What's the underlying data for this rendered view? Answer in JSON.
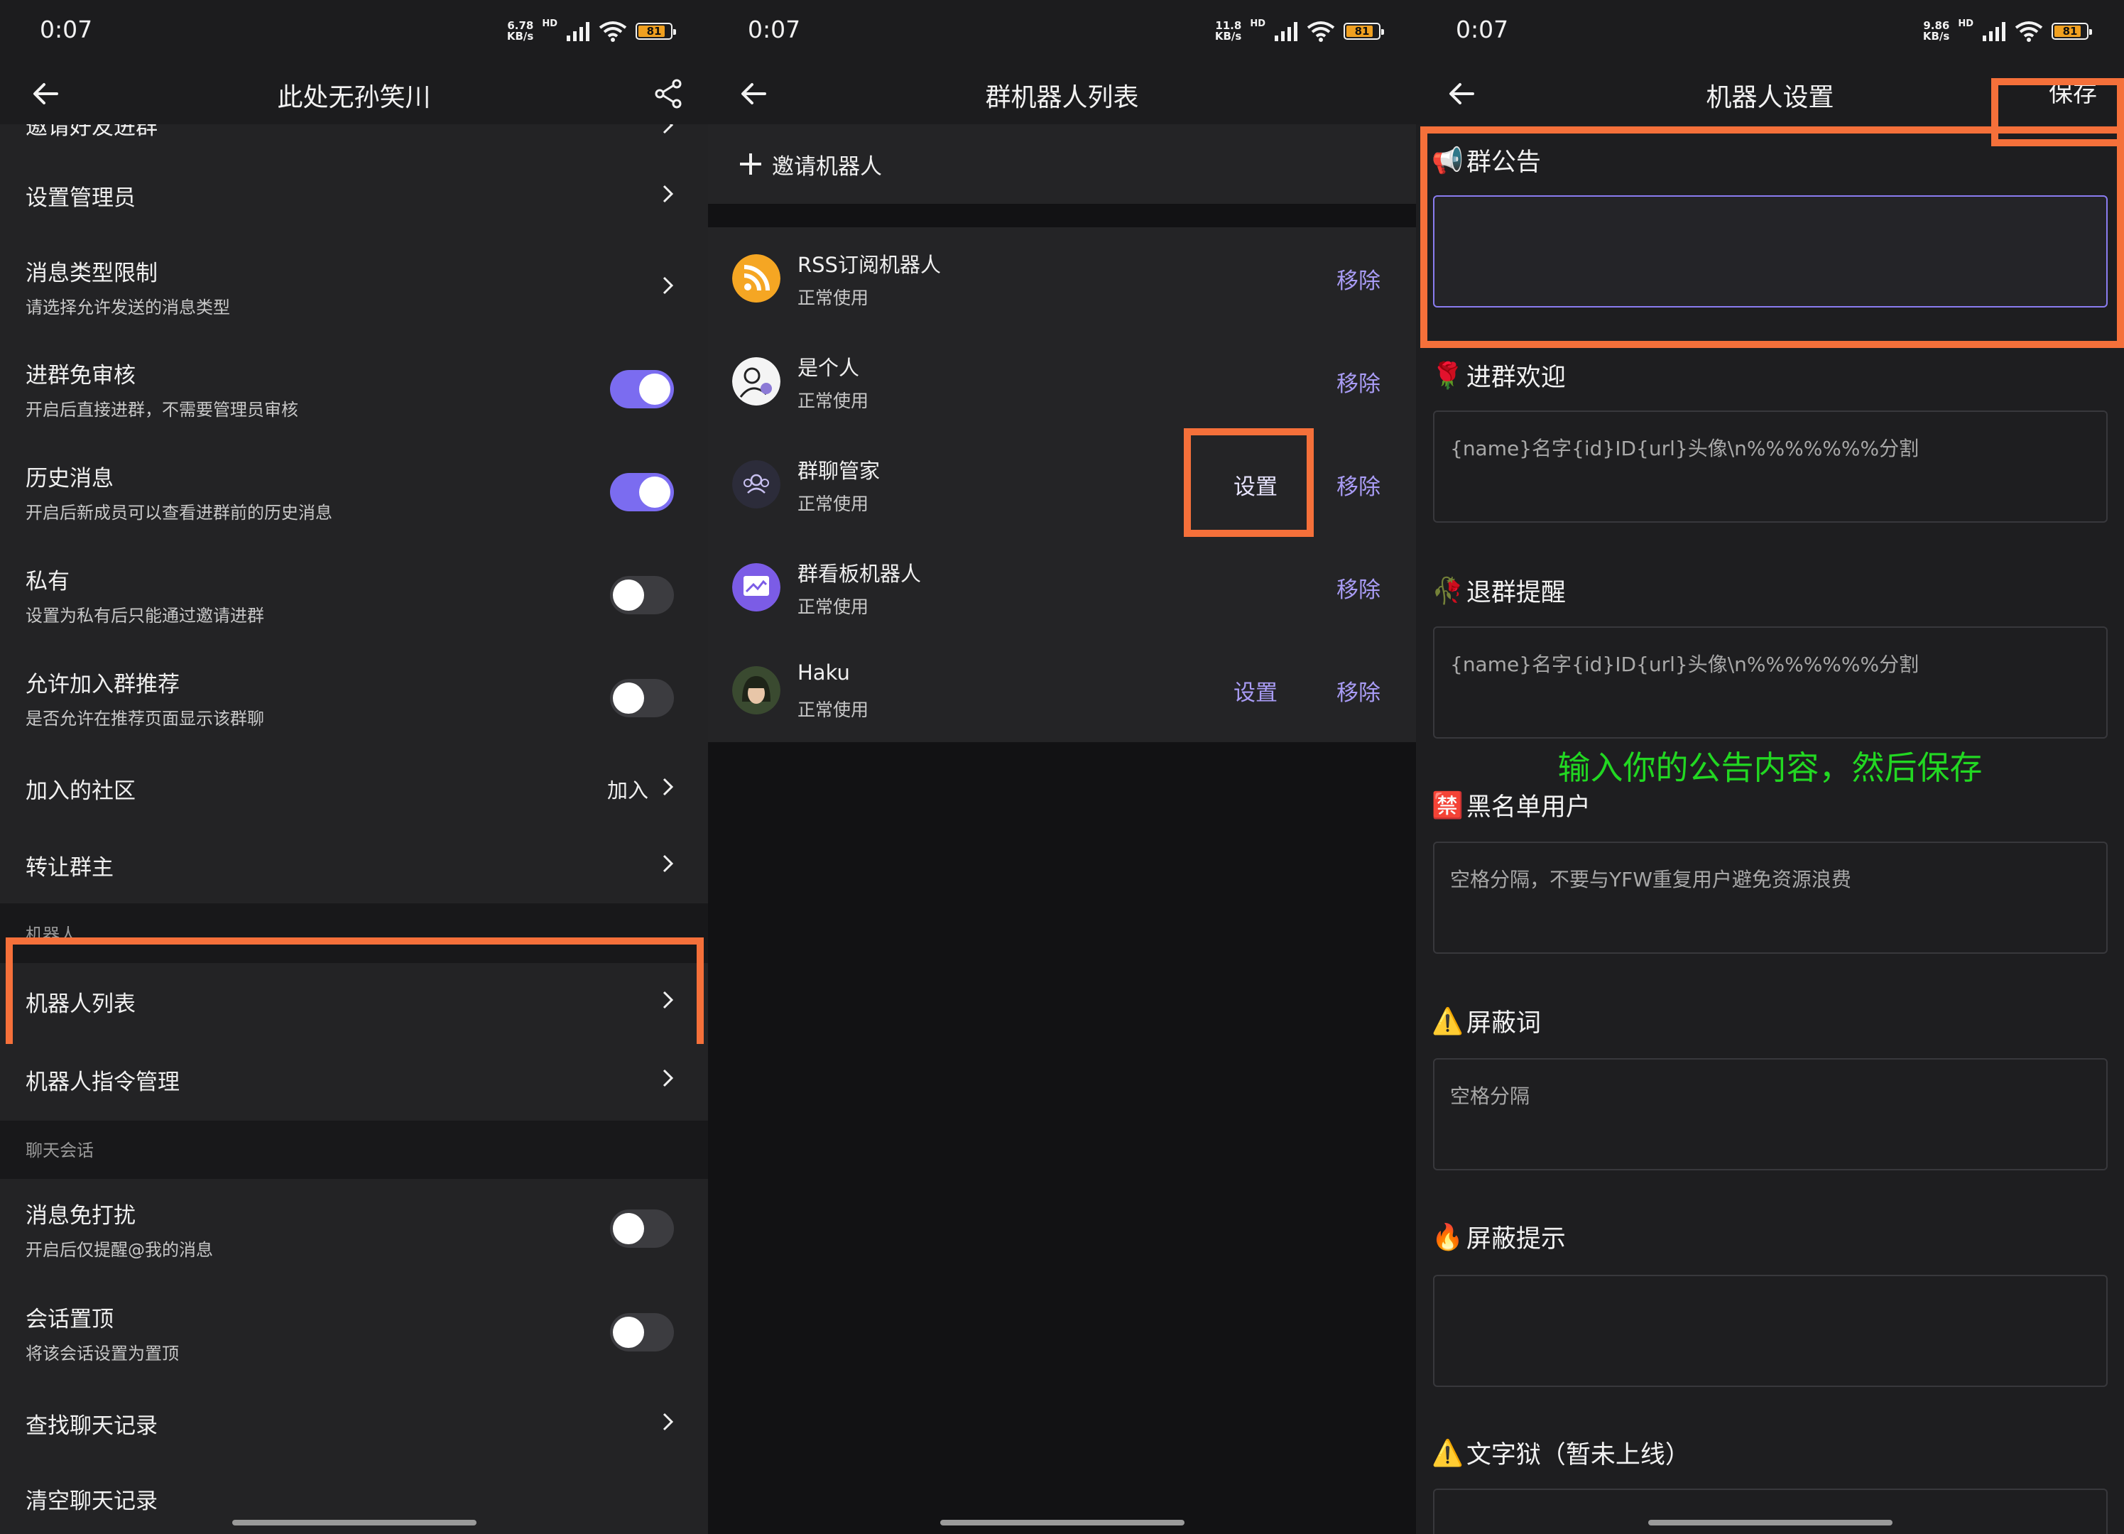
{
  "status": {
    "time": "0:07",
    "panels": [
      {
        "speed": "6.78",
        "unit": "KB/s",
        "battery": "81"
      },
      {
        "speed": "11.8",
        "unit": "KB/s",
        "battery": "81"
      },
      {
        "speed": "9.86",
        "unit": "KB/s",
        "battery": "81"
      }
    ],
    "hd": "HD"
  },
  "panel1": {
    "title": "此处无孙笑川",
    "cut_row": "邀请好友进群",
    "rows": [
      {
        "title": "设置管理员"
      },
      {
        "title": "消息类型限制",
        "sub": "请选择允许发送的消息类型"
      },
      {
        "title": "进群免审核",
        "sub": "开启后直接进群，不需要管理员审核"
      },
      {
        "title": "历史消息",
        "sub": "开启后新成员可以查看进群前的历史消息"
      },
      {
        "title": "私有",
        "sub": "设置为私有后只能通过邀请进群"
      },
      {
        "title": "允许加入群推荐",
        "sub": "是否允许在推荐页面显示该群聊"
      },
      {
        "title": "加入的社区",
        "value": "加入"
      },
      {
        "title": "转让群主"
      }
    ],
    "section_robot": "机器人",
    "robot_rows": [
      {
        "title": "机器人列表"
      },
      {
        "title": "机器人指令管理"
      }
    ],
    "section_chat": "聊天会话",
    "chat_rows": [
      {
        "title": "消息免打扰",
        "sub": "开启后仅提醒@我的消息"
      },
      {
        "title": "会话置顶",
        "sub": "将该会话设置为置顶"
      },
      {
        "title": "查找聊天记录"
      },
      {
        "title": "清空聊天记录"
      }
    ]
  },
  "panel2": {
    "title": "群机器人列表",
    "invite": "邀请机器人",
    "bots": [
      {
        "name": "RSS订阅机器人",
        "status": "正常使用",
        "remove": "移除"
      },
      {
        "name": "是个人",
        "status": "正常使用",
        "remove": "移除"
      },
      {
        "name": "群聊管家",
        "status": "正常使用",
        "setting": "设置",
        "remove": "移除"
      },
      {
        "name": "群看板机器人",
        "status": "正常使用",
        "remove": "移除"
      },
      {
        "name": "Haku",
        "status": "正常使用",
        "setting": "设置",
        "remove": "移除"
      }
    ]
  },
  "panel3": {
    "title": "机器人设置",
    "save": "保存",
    "annotation": "输入你的公告内容，然后保存",
    "fields": [
      {
        "emoji": "📢",
        "label": "群公告",
        "value": ""
      },
      {
        "emoji": "🌹",
        "label": "进群欢迎",
        "placeholder": "{name}名字{id}ID{url}头像\\n%%%%%%%分割"
      },
      {
        "emoji": "🥀",
        "label": "退群提醒",
        "placeholder": "{name}名字{id}ID{url}头像\\n%%%%%%%分割"
      },
      {
        "emoji": "🈲",
        "label": "黑名单用户",
        "placeholder": "空格分隔，不要与YFW重复用户避免资源浪费"
      },
      {
        "emoji": "⚠️",
        "label": "屏蔽词",
        "placeholder": "空格分隔"
      },
      {
        "emoji": "🔥",
        "label": "屏蔽提示",
        "placeholder": ""
      },
      {
        "emoji": "⚠️",
        "label": "文字狱（暂未上线）"
      }
    ]
  },
  "colors": {
    "accent": "#7b6cf0",
    "link": "#a99cf5",
    "highlight": "#f5703a",
    "annotation": "#22d822"
  }
}
